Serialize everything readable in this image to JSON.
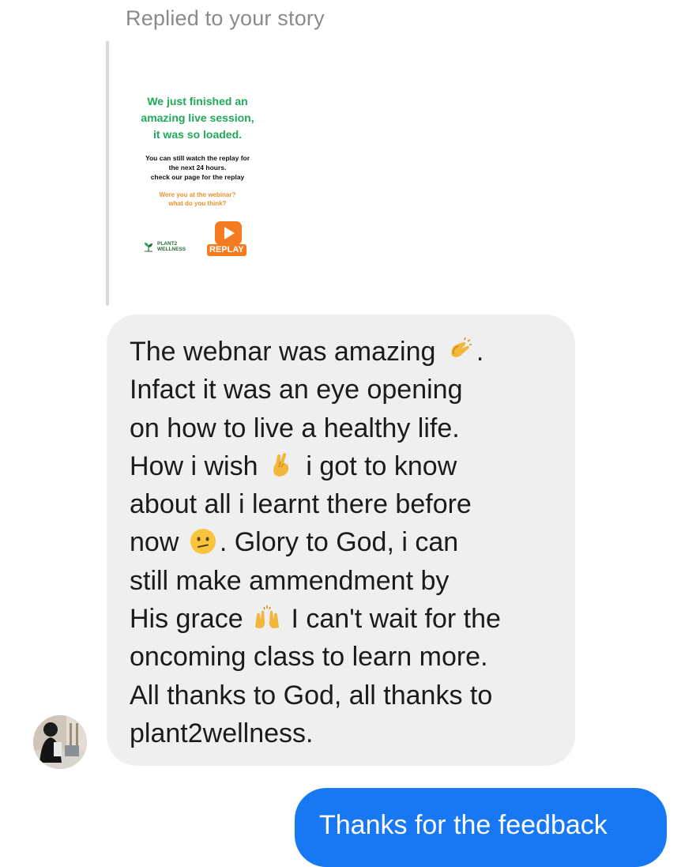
{
  "reply_context": {
    "label": "Replied to your story"
  },
  "story": {
    "headline_lines": [
      "We just finished an",
      "amazing live session,",
      "it was so loaded."
    ],
    "body_lines": [
      "You can still watch the replay for",
      "the next 24 hours.",
      "check our page for the replay"
    ],
    "question_lines": [
      "Were you at the webinar?",
      "what do you think?"
    ],
    "logo_lines": [
      "PLANT2",
      "WELLNESS"
    ],
    "replay_label": "REPLAY",
    "colors": {
      "headline": "#1faa59",
      "question": "#e8922e",
      "replay": "#f47b20"
    }
  },
  "incoming_message": {
    "avatar_icon": "contact-avatar",
    "lines": [
      {
        "before": "The webnar was amazing ",
        "emoji": "clapping-hands-emoji",
        "after": "."
      },
      {
        "before": "Infact it was an eye opening"
      },
      {
        "before": "on how to live a healthy life."
      },
      {
        "before": "How i wish ",
        "emoji": "crossed-fingers-emoji",
        "after": " i got to know"
      },
      {
        "before": "about all i learnt there before"
      },
      {
        "before": "now ",
        "emoji": "confused-face-emoji",
        "after": ". Glory to God, i can"
      },
      {
        "before": "still make ammendment by"
      },
      {
        "before": "His grace ",
        "emoji": "raising-hands-emoji",
        "after": " I can't wait for the"
      },
      {
        "before": "oncoming class to learn more."
      },
      {
        "before": "All thanks to God, all thanks to"
      },
      {
        "before": "plant2wellness."
      }
    ]
  },
  "outgoing_message": {
    "text": "Thanks for the feedback",
    "color": "#1877f2"
  }
}
